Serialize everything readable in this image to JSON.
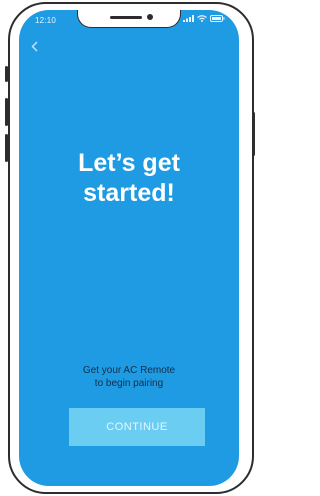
{
  "status_bar": {
    "time": "12:10",
    "icons": [
      "signal-icon",
      "wifi-icon",
      "battery-icon"
    ]
  },
  "nav": {
    "back_icon": "chevron-left-icon"
  },
  "content": {
    "title": "Let’s get\nstarted!",
    "subtitle": "Get your AC Remote\nto begin pairing"
  },
  "actions": {
    "continue_label": "CONTINUE"
  },
  "colors": {
    "screen_background": "#1e9be3",
    "button_background": "#6ccdf3",
    "title_text": "#ffffff",
    "subtitle_text": "#10304a",
    "device_frame": "#2d2d2d"
  }
}
